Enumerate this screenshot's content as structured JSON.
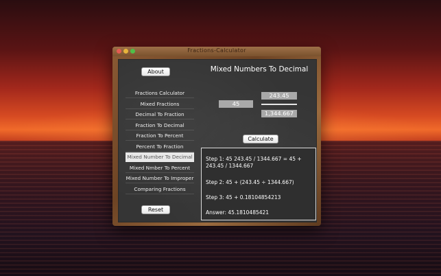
{
  "window": {
    "title": "Fractions-Calculator"
  },
  "about_label": "About",
  "reset_label": "Reset",
  "calculate_label": "Calculate",
  "heading": "Mixed Numbers To Decimal",
  "sidebar": {
    "items": [
      {
        "label": "Fractions Calculator"
      },
      {
        "label": "Mixed Fractions"
      },
      {
        "label": "Decimal To Fraction"
      },
      {
        "label": "Fraction To Decimal"
      },
      {
        "label": "Fraction To Percent"
      },
      {
        "label": "Percent To Fraction"
      },
      {
        "label": "Mixed Number To Decimal"
      },
      {
        "label": "Mixed Nmber To Percent"
      },
      {
        "label": "Mixed Number To Improper"
      },
      {
        "label": "Comparing Fractions"
      }
    ],
    "selected_index": 6
  },
  "inputs": {
    "whole": "45",
    "numerator": "243.45",
    "denominator": "1,344.667"
  },
  "result": {
    "step1": "Step 1: 45 243.45 / 1344.667 = 45 + 243.45 / 1344.667",
    "step2": "Step 2:  45 + (243.45 ÷ 1344.667)",
    "step3": "Step 3:  45 + 0.18104854213",
    "answer": "Answer:  45.1810485421"
  },
  "colors": {
    "board": "#353535",
    "frame": "#7a522e",
    "field": "#a9a9a9",
    "selected": "#e8e8e8"
  }
}
